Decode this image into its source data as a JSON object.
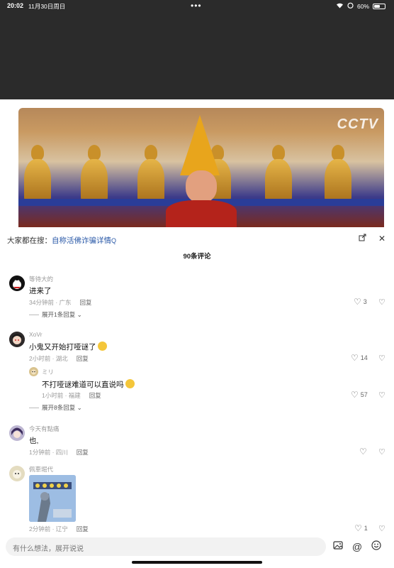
{
  "status_bar": {
    "time": "20:02",
    "date": "11月30日周日",
    "battery": "60%",
    "battery_level": 0.6
  },
  "video": {
    "watermark": "CCTV"
  },
  "sheet": {
    "search_prefix": "大家都在搜：",
    "search_link": "自称活佛诈骗详情",
    "comment_count": "90条评论"
  },
  "comments": [
    {
      "user": "等待大的",
      "text": "进来了",
      "time_loc": "34分钟前 · 广东",
      "reply": "回复",
      "likes": "3",
      "expand": "展开1条回复"
    },
    {
      "user": "XoVr",
      "text": "小鬼又开始打哑谜了",
      "time_loc": "2小时前 · 湖北",
      "reply": "回复",
      "likes": "14",
      "expand": "展开8条回复",
      "sub": {
        "user": "ミリ",
        "text": "不打哑谜难道可以直说吗",
        "time_loc": "1小时前 · 福建",
        "reply": "回复",
        "likes": "57"
      }
    },
    {
      "user": "今天有點痛",
      "text": "也,",
      "time_loc": "1分钟前 · 四川",
      "reply": "回复",
      "likes": ""
    },
    {
      "user": "佩車堀代",
      "text": "",
      "time_loc": "2分钟前 · 辽宁",
      "reply": "回复",
      "likes": "1"
    }
  ],
  "input": {
    "placeholder": "有什么想法，展开说说"
  },
  "icons": [
    "wifi-icon",
    "alarm-icon",
    "battery-icon",
    "more-dots-icon",
    "share-icon",
    "close-icon",
    "heart-icon",
    "dislike-icon",
    "chevron-down-icon",
    "image-icon",
    "at-icon",
    "emoji-icon"
  ]
}
